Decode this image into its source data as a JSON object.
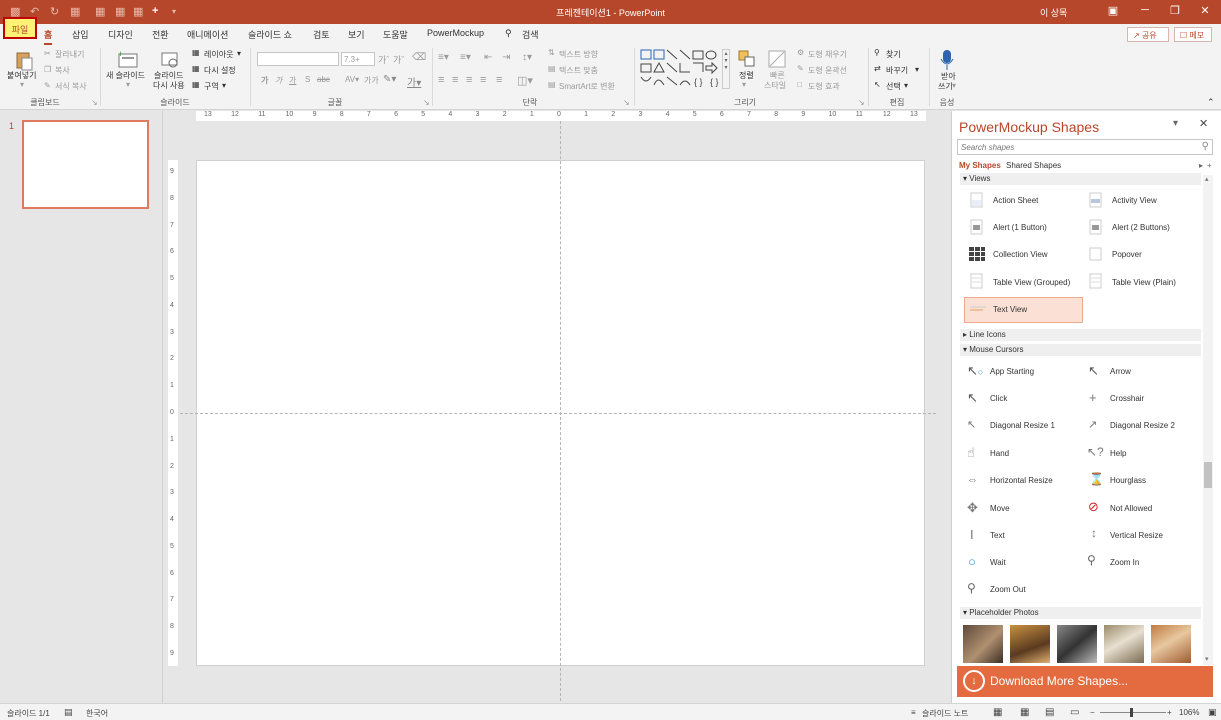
{
  "window": {
    "title": "프레젠테이션1 - PowerPoint",
    "user": "이 상목",
    "buttons": {
      "ribbon_options": "▣",
      "minimize": "─",
      "maximize": "❐",
      "close": "✕"
    }
  },
  "quick_access": [
    "save-icon",
    "undo-icon",
    "redo-icon",
    "start-icon",
    "new-icon",
    "add-icon",
    "customize-icon"
  ],
  "tabs": [
    "파일",
    "홈",
    "삽입",
    "디자인",
    "전환",
    "애니메이션",
    "슬라이드 쇼",
    "검토",
    "보기",
    "도움말",
    "PowerMockup"
  ],
  "search_tab": "검색",
  "share_button": "공유",
  "comment_button": "메모",
  "ribbon": {
    "clipboard": {
      "paste": "붙여넣기",
      "cut": "잘라내기",
      "copy": "복사",
      "format_painter": "서식 복사",
      "label": "클립보드"
    },
    "slides": {
      "new_slide": "새 슬라이드",
      "reuse_slide_1": "슬라이드",
      "reuse_slide_2": "다시 사용",
      "layout": "레이아웃",
      "reset": "다시 설정",
      "section": "구역",
      "label": "슬라이드"
    },
    "font": {
      "size": "7.3+",
      "label": "글꼴",
      "bold": "가",
      "italic": "가",
      "underline": "가",
      "strike": "S",
      "spacing": "abc",
      "case": "가가"
    },
    "paragraph": {
      "text_direction": "텍스트 방향",
      "align_text": "텍스트 맞춤",
      "smartart": "SmartArt로 변환",
      "label": "단락"
    },
    "drawing": {
      "arrange": "정렬",
      "quick_styles_1": "빠른",
      "quick_styles_2": "스타일",
      "fill": "도형 채우기",
      "outline": "도형 윤곽선",
      "effects": "도형 효과",
      "label": "그리기"
    },
    "editing": {
      "find": "찾기",
      "replace": "바꾸기",
      "select": "선택",
      "label": "편집"
    },
    "voice": {
      "dictate_1": "받아",
      "dictate_2": "쓰기",
      "label": "음성"
    }
  },
  "slide_pane": {
    "slide_number": "1"
  },
  "rulers": {
    "horizontal": [
      "13",
      "12",
      "11",
      "10",
      "9",
      "8",
      "7",
      "6",
      "5",
      "4",
      "3",
      "2",
      "1",
      "0",
      "1",
      "2",
      "3",
      "4",
      "5",
      "6",
      "7",
      "8",
      "9",
      "10",
      "11",
      "12",
      "13"
    ],
    "vertical": [
      "9",
      "8",
      "7",
      "6",
      "5",
      "4",
      "3",
      "2",
      "1",
      "0",
      "1",
      "2",
      "3",
      "4",
      "5",
      "6",
      "7",
      "8",
      "9"
    ]
  },
  "powermockup": {
    "title": "PowerMockup Shapes",
    "search_placeholder": "Search shapes",
    "tab_my": "My Shapes",
    "tab_shared": "Shared Shapes",
    "sections": {
      "views": "Views",
      "line_icons": "Line Icons",
      "mouse_cursors": "Mouse Cursors",
      "placeholder_photos": "Placeholder Photos"
    },
    "views_items": [
      "Action Sheet",
      "Activity View",
      "Alert (1 Button)",
      "Alert (2 Buttons)",
      "Collection View",
      "Popover",
      "Table View (Grouped)",
      "Table View (Plain)",
      "Text View"
    ],
    "cursor_items": [
      "App Starting",
      "Arrow",
      "Click",
      "Crosshair",
      "Diagonal Resize 1",
      "Diagonal Resize 2",
      "Hand",
      "Help",
      "Horizontal Resize",
      "Hourglass",
      "Move",
      "Not Allowed",
      "Text",
      "Vertical Resize",
      "Wait",
      "Zoom In",
      "Zoom Out"
    ],
    "download_label": "Download More Shapes..."
  },
  "status": {
    "slide_info": "슬라이드 1/1",
    "language": "한국어",
    "notes": "슬라이드 노트",
    "zoom": "106%"
  },
  "colors": {
    "accent": "#b7472a",
    "download": "#e36b3f",
    "selected_item": "#fbe0d6"
  }
}
